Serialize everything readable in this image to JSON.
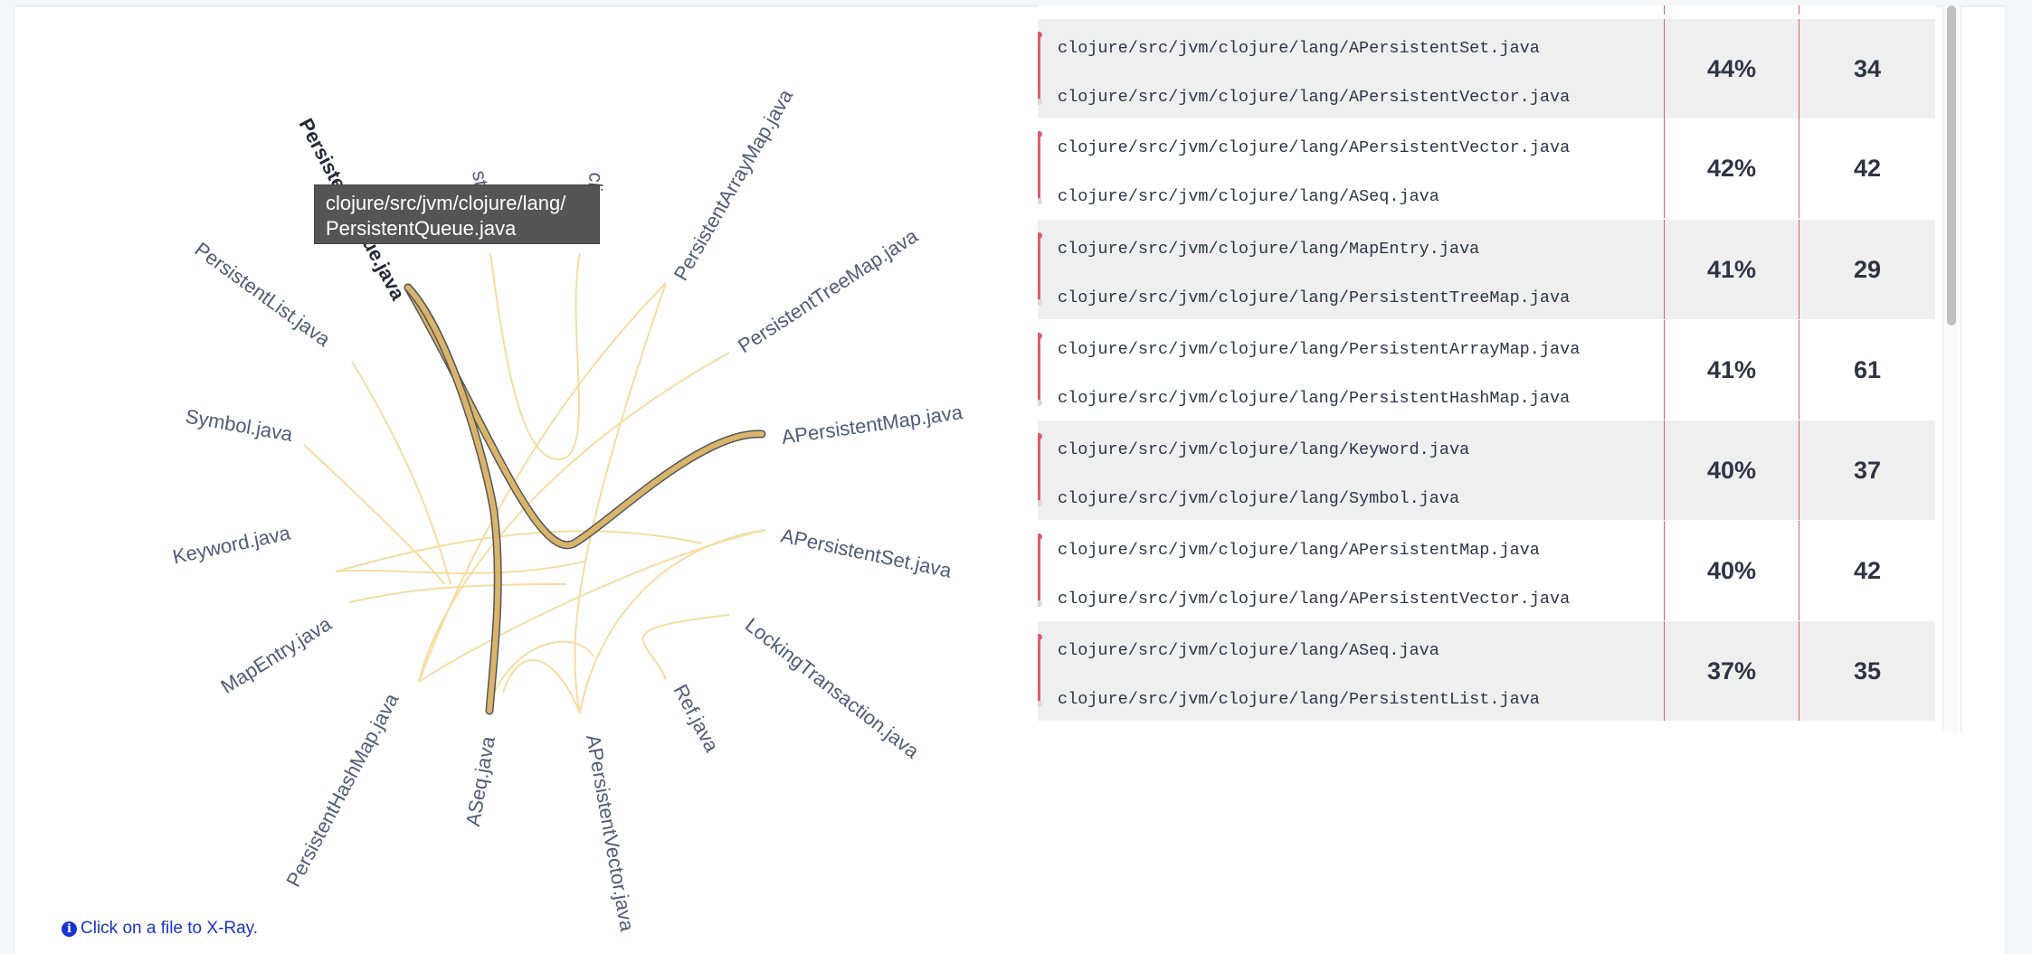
{
  "chord": {
    "labels": [
      {
        "text": "PersistentQueue.java",
        "active": true
      },
      {
        "text": "st"
      },
      {
        "text": "cljc"
      },
      {
        "text": "PersistentArrayMap.java"
      },
      {
        "text": "PersistentTreeMap.java"
      },
      {
        "text": "APersistentMap.java"
      },
      {
        "text": "APersistentSet.java"
      },
      {
        "text": "LockingTransaction.java"
      },
      {
        "text": "Ref.java"
      },
      {
        "text": "APersistentVector.java"
      },
      {
        "text": "ASeq.java"
      },
      {
        "text": "PersistentHashMap.java"
      },
      {
        "text": "MapEntry.java"
      },
      {
        "text": "Keyword.java"
      },
      {
        "text": "Symbol.java"
      },
      {
        "text": "PersistentList.java"
      }
    ],
    "highlight_color": "#d9b56b",
    "link_color": "#f6dca2"
  },
  "tooltip": {
    "text": "clojure/src/jvm/clojure/lang/\nPersistentQueue.java"
  },
  "hint": {
    "text": "Click on a file to X-Ray.",
    "icon": "info-icon"
  },
  "table": {
    "rows": [
      {
        "file1": "clojure/src/jvm/clojure/lang/APersistentSet.java",
        "file2": "clojure/src/jvm/clojure/lang/APersistentVector.java",
        "pct": "44%",
        "count": "34"
      },
      {
        "file1": "clojure/src/jvm/clojure/lang/APersistentVector.java",
        "file2": "clojure/src/jvm/clojure/lang/ASeq.java",
        "pct": "42%",
        "count": "42"
      },
      {
        "file1": "clojure/src/jvm/clojure/lang/MapEntry.java",
        "file2": "clojure/src/jvm/clojure/lang/PersistentTreeMap.java",
        "pct": "41%",
        "count": "29"
      },
      {
        "file1": "clojure/src/jvm/clojure/lang/PersistentArrayMap.java",
        "file2": "clojure/src/jvm/clojure/lang/PersistentHashMap.java",
        "pct": "41%",
        "count": "61"
      },
      {
        "file1": "clojure/src/jvm/clojure/lang/Keyword.java",
        "file2": "clojure/src/jvm/clojure/lang/Symbol.java",
        "pct": "40%",
        "count": "37"
      },
      {
        "file1": "clojure/src/jvm/clojure/lang/APersistentMap.java",
        "file2": "clojure/src/jvm/clojure/lang/APersistentVector.java",
        "pct": "40%",
        "count": "42"
      },
      {
        "file1": "clojure/src/jvm/clojure/lang/ASeq.java",
        "file2": "clojure/src/jvm/clojure/lang/PersistentList.java",
        "pct": "37%",
        "count": "35"
      }
    ]
  }
}
